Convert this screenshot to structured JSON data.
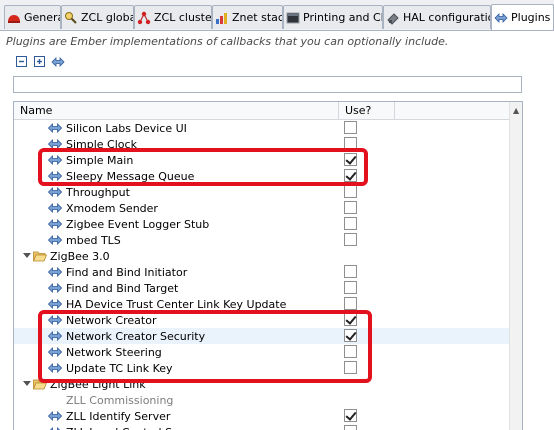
{
  "tabs": [
    {
      "label": "General",
      "icon": "general-icon",
      "active": false
    },
    {
      "label": "ZCL global",
      "icon": "zcl-global-icon",
      "active": false
    },
    {
      "label": "ZCL clusters",
      "icon": "zcl-clusters-icon",
      "active": false
    },
    {
      "label": "Znet stack",
      "icon": "znet-stack-icon",
      "active": false
    },
    {
      "label": "Printing and CLI",
      "icon": "printing-cli-icon",
      "active": false
    },
    {
      "label": "HAL configuration",
      "icon": "hal-configuration-icon",
      "active": false
    },
    {
      "label": "Plugins",
      "icon": "plugin-icon",
      "active": true
    }
  ],
  "description": "Plugins are Ember implementations of callbacks that you can optionally include.",
  "toolbar": {
    "collapse_icon": "collapse-all-icon",
    "expand_icon": "expand-all-icon",
    "plugin_icon": "plugin-icon"
  },
  "filter": {
    "value": ""
  },
  "table": {
    "headers": {
      "name": "Name",
      "use": "Use?"
    },
    "rows": [
      {
        "label": "Silicon Labs Device UI",
        "type": "plugin",
        "checked": false
      },
      {
        "label": "Simple Clock",
        "type": "plugin",
        "checked": false
      },
      {
        "label": "Simple Main",
        "type": "plugin",
        "checked": true
      },
      {
        "label": "Sleepy Message Queue",
        "type": "plugin",
        "checked": true
      },
      {
        "label": "Throughput",
        "type": "plugin",
        "checked": false
      },
      {
        "label": "Xmodem Sender",
        "type": "plugin",
        "checked": false
      },
      {
        "label": "Zigbee Event Logger Stub",
        "type": "plugin",
        "checked": false
      },
      {
        "label": "mbed TLS",
        "type": "plugin",
        "checked": false
      },
      {
        "label": "ZigBee 3.0",
        "type": "category"
      },
      {
        "label": "Find and Bind Initiator",
        "type": "plugin",
        "checked": false
      },
      {
        "label": "Find and Bind Target",
        "type": "plugin",
        "checked": false
      },
      {
        "label": "HA Device Trust Center Link Key Update",
        "type": "plugin",
        "checked": false
      },
      {
        "label": "Network Creator",
        "type": "plugin",
        "checked": true
      },
      {
        "label": "Network Creator Security",
        "type": "plugin",
        "checked": true,
        "selected": true
      },
      {
        "label": "Network Steering",
        "type": "plugin",
        "checked": false
      },
      {
        "label": "Update TC Link Key",
        "type": "plugin",
        "checked": false
      },
      {
        "label": "ZigBee Light Link",
        "type": "category"
      },
      {
        "label": "ZLL Commissioning",
        "type": "plugin-disabled"
      },
      {
        "label": "ZLL Identify Server",
        "type": "plugin",
        "checked": true
      },
      {
        "label": "ZLL Level Control Server",
        "type": "plugin",
        "checked": false
      }
    ]
  },
  "colors": {
    "highlight": "#e3101e",
    "selection": "#eaf2fb",
    "tab_border": "#a9b3c1"
  }
}
